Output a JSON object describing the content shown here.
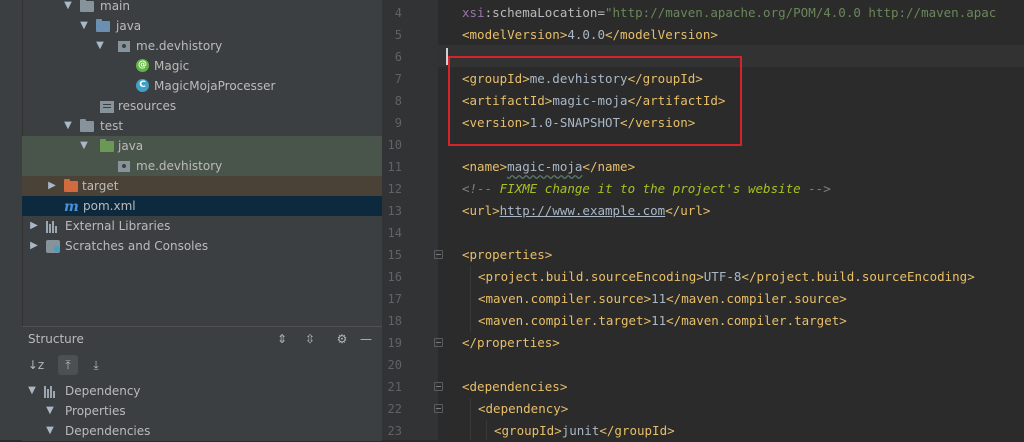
{
  "project_tree": {
    "items": [
      {
        "label": "main",
        "icon": "folder-icon",
        "expanded": true
      },
      {
        "label": "java",
        "icon": "source-folder-icon",
        "expanded": true
      },
      {
        "label": "me.devhistory",
        "icon": "package-icon",
        "expanded": true
      },
      {
        "label": "Magic",
        "icon": "spring-class-icon",
        "badge": "@"
      },
      {
        "label": "MagicMojaProcesser",
        "icon": "class-icon",
        "badge": "C"
      },
      {
        "label": "resources",
        "icon": "resources-folder-icon"
      },
      {
        "label": "test",
        "icon": "folder-icon",
        "expanded": true
      },
      {
        "label": "java",
        "icon": "test-folder-icon",
        "expanded": true
      },
      {
        "label": "me.devhistory",
        "icon": "package-icon"
      },
      {
        "label": "target",
        "icon": "excluded-folder-icon",
        "expanded": false
      },
      {
        "label": "pom.xml",
        "icon": "maven-icon",
        "glyph": "m"
      },
      {
        "label": "External Libraries",
        "icon": "libraries-icon",
        "expanded": false
      },
      {
        "label": "Scratches and Consoles",
        "icon": "scratches-icon",
        "expanded": false
      }
    ]
  },
  "structure": {
    "title": "Structure",
    "items": [
      {
        "label": "Dependency"
      },
      {
        "label": "Properties"
      },
      {
        "label": "Dependencies"
      }
    ]
  },
  "editor": {
    "line_numbers": [
      "4",
      "5",
      "6",
      "7",
      "8",
      "9",
      "10",
      "11",
      "12",
      "13",
      "14",
      "15",
      "16",
      "17",
      "18",
      "19",
      "20",
      "21",
      "22",
      "23"
    ],
    "line4": {
      "ns": "xsi",
      "attr": ":schemaLocation=",
      "value": "\"http://maven.apache.org/POM/4.0.0 http://maven.apac"
    },
    "line5": {
      "open": "<modelVersion>",
      "text": "4.0.0",
      "close": "</modelVersion>"
    },
    "line7": {
      "open": "<groupId>",
      "text": "me.devhistory",
      "close": "</groupId>"
    },
    "line8": {
      "open": "<artifactId>",
      "text": "magic-moja",
      "close": "</artifactId>"
    },
    "line9": {
      "open": "<version>",
      "text": "1.0-SNAPSHOT",
      "close": "</version>"
    },
    "line11": {
      "open": "<name>",
      "text": "magic-moja",
      "close": "</name>"
    },
    "line12": {
      "open": "<!-- ",
      "text": "FIXME change it to the project's website",
      "close": " -->"
    },
    "line13": {
      "open": "<url>",
      "text": "http://www.example.com",
      "close": "</url>"
    },
    "line15": {
      "open": "<properties>"
    },
    "line16": {
      "open": "<project.build.sourceEncoding>",
      "text": "UTF-8",
      "close": "</project.build.sourceEncoding>"
    },
    "line17": {
      "open": "<maven.compiler.source>",
      "text": "11",
      "close": "</maven.compiler.source>"
    },
    "line18": {
      "open": "<maven.compiler.target>",
      "text": "11",
      "close": "</maven.compiler.target>"
    },
    "line19": {
      "close": "</properties>"
    },
    "line21": {
      "open": "<dependencies>"
    },
    "line22": {
      "open": "<dependency>"
    },
    "line23": {
      "open": "<groupId>",
      "text": "junit",
      "close": "</groupId>"
    }
  },
  "colors": {
    "highlight_box": "#d4232b",
    "tag": "#e8bf6a",
    "text": "#a9b7c6",
    "string": "#6a8759",
    "comment_todo": "#a8c023"
  }
}
